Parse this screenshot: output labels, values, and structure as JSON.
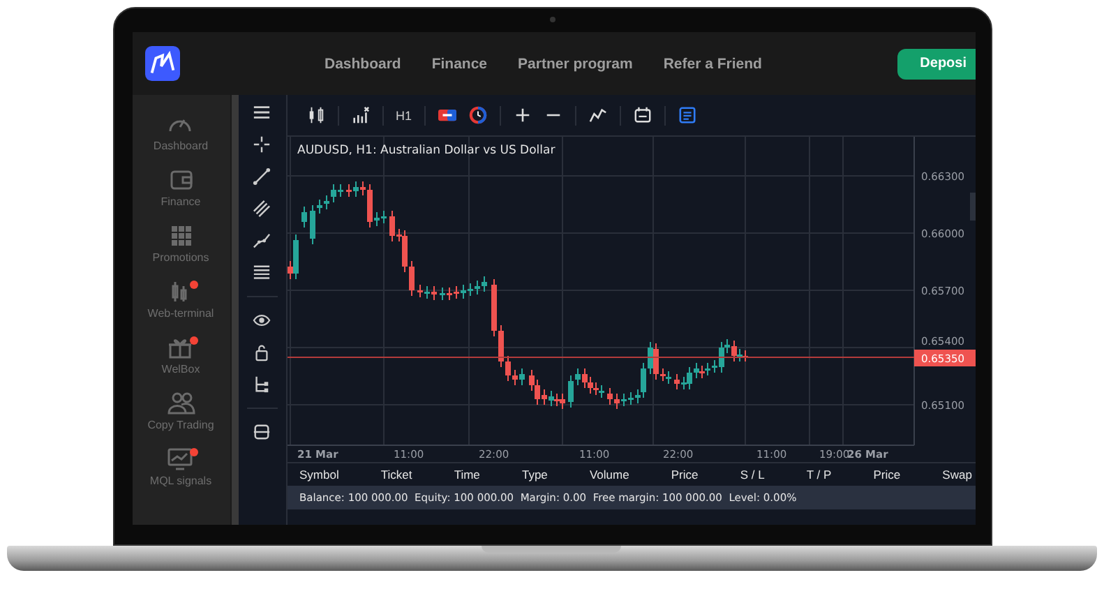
{
  "nav": {
    "links": [
      "Dashboard",
      "Finance",
      "Partner program",
      "Refer a Friend"
    ],
    "deposit_button": "Deposi"
  },
  "sidebar": {
    "items": [
      {
        "label": "Dashboard",
        "notification": false
      },
      {
        "label": "Finance",
        "notification": false
      },
      {
        "label": "Promotions",
        "notification": false
      },
      {
        "label": "Web-terminal",
        "notification": true
      },
      {
        "label": "WelBox",
        "notification": true
      },
      {
        "label": "Copy Trading",
        "notification": false
      },
      {
        "label": "MQL signals",
        "notification": true
      }
    ]
  },
  "toolbar": {
    "timeframe": "H1"
  },
  "chart": {
    "title": "AUDUSD, H1: Australian Dollar vs US Dollar",
    "price_labels": [
      "0.66300",
      "0.66000",
      "0.65700",
      "0.65400",
      "0.65100"
    ],
    "current_price": "0.65350",
    "time_labels": [
      "21 Mar",
      "11:00",
      "22:00",
      "11:00",
      "22:00",
      "11:00",
      "19:00",
      "26 Mar"
    ]
  },
  "positions_table": {
    "columns": [
      "Symbol",
      "Ticket",
      "Time",
      "Type",
      "Volume",
      "Price",
      "S / L",
      "T / P",
      "Price",
      "Swap"
    ]
  },
  "account_summary": "Balance: 100 000.00  Equity: 100 000.00  Margin: 0.00  Free margin: 100 000.00  Level: 0.00%"
}
